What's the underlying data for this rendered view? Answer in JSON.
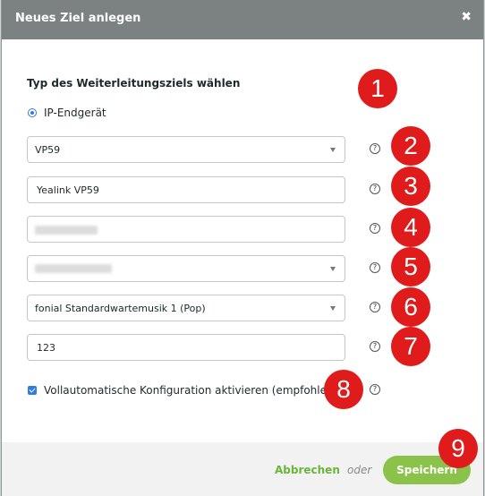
{
  "dialog": {
    "title": "Neues Ziel anlegen",
    "close_icon": "✖"
  },
  "form": {
    "section_title": "Typ des Weiterleitungsziels wählen",
    "radio_label": "IP-Endgerät",
    "device_model": "VP59",
    "device_name": "Yealink VP59",
    "field_4": "",
    "select_5": "",
    "hold_music": "fonial Standardwartemusik 1 (Pop)",
    "number_value": "123",
    "auto_config_label": "Vollautomatische Konfiguration aktivieren (empfohlen)",
    "help_icon": "?"
  },
  "footer": {
    "cancel_label": "Abbrechen",
    "or_label": "oder",
    "save_label": "Speichern"
  },
  "badges": [
    "1",
    "2",
    "3",
    "4",
    "5",
    "6",
    "7",
    "8",
    "9"
  ],
  "colors": {
    "header_bg": "#7c8282",
    "accent_green": "#8bc34a",
    "link_green": "#6bb53b",
    "badge_red": "#e01b1b",
    "radio_blue": "#2f7de2"
  }
}
